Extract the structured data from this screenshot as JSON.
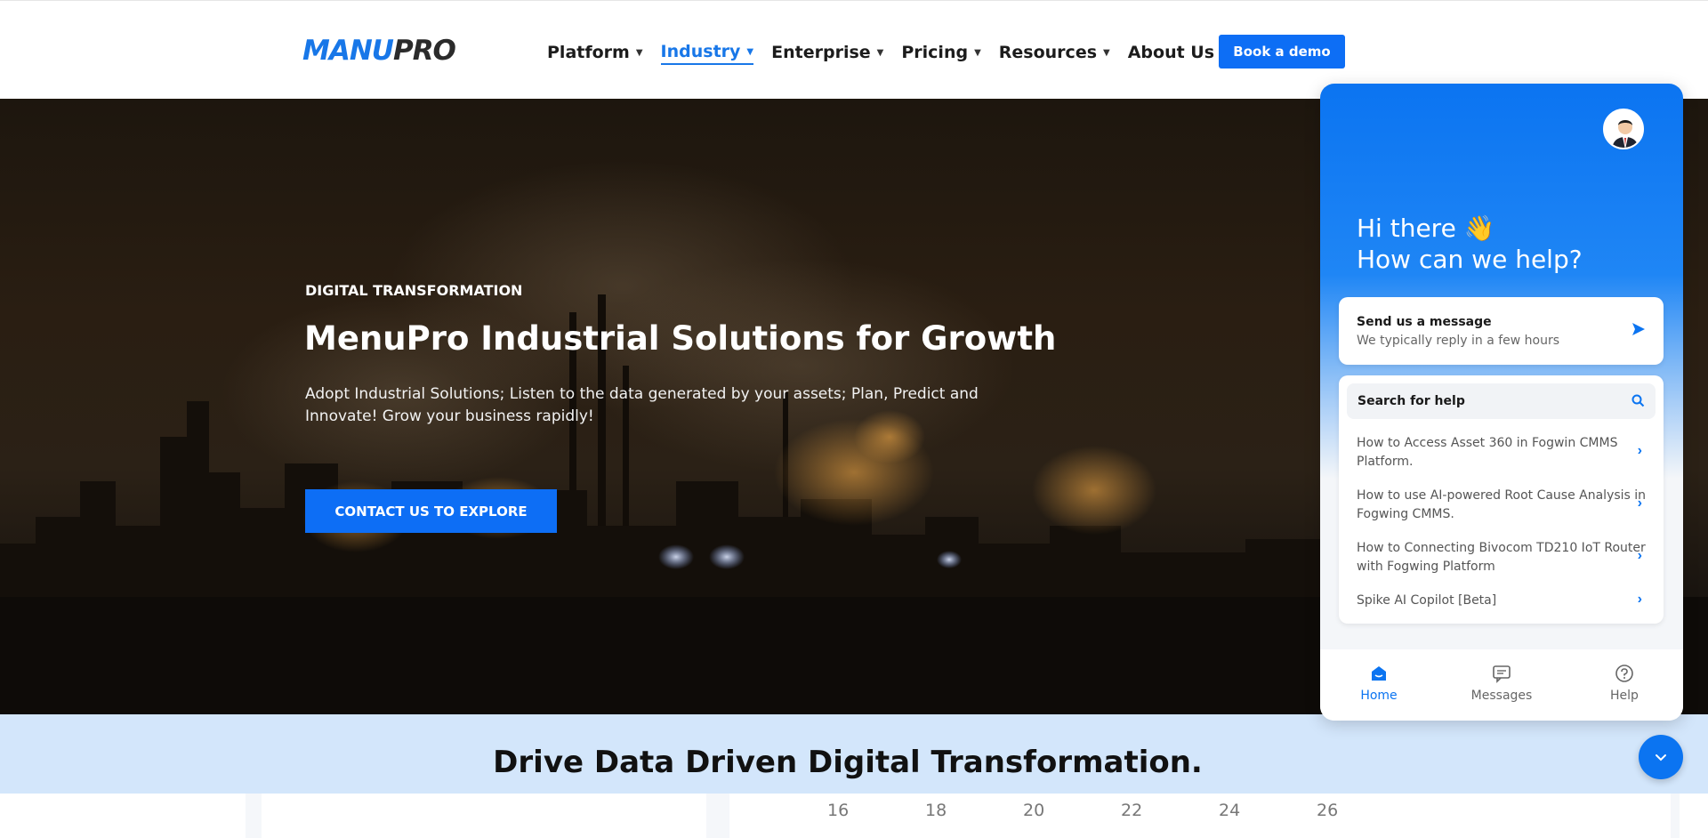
{
  "header": {
    "logo_part1": "MANU",
    "logo_part2": "PRO",
    "nav": [
      {
        "label": "Platform"
      },
      {
        "label": "Industry",
        "active": true
      },
      {
        "label": "Enterprise"
      },
      {
        "label": "Pricing"
      },
      {
        "label": "Resources"
      },
      {
        "label": "About Us"
      }
    ],
    "demo_label": "Book a demo"
  },
  "hero": {
    "eyebrow": "DIGITAL TRANSFORMATION",
    "title": "MenuPro Industrial Solutions for Growth",
    "subtitle": "Adopt Industrial Solutions; Listen to the data generated by your assets; Plan, Predict and Innovate! Grow your business rapidly!",
    "cta_label": "CONTACT US TO EXPLORE"
  },
  "band": {
    "title": "Drive Data Driven Digital Transformation."
  },
  "calendar": {
    "days": [
      "16",
      "18",
      "20",
      "22",
      "24",
      "26"
    ]
  },
  "chat": {
    "greeting_line1": "Hi there 👋",
    "greeting_line2": "How can we help?",
    "message_title": "Send us a message",
    "message_sub": "We typically reply in a few hours",
    "search_label": "Search for help",
    "articles": [
      {
        "title": "How to Access Asset 360 in Fogwin CMMS Platform."
      },
      {
        "title": "How to use AI-powered Root Cause Analysis in Fogwing CMMS."
      },
      {
        "title": "How to Connecting Bivocom TD210 IoT Router with Fogwing Platform"
      },
      {
        "title": "Spike AI Copilot [Beta]"
      }
    ],
    "tabs": [
      {
        "label": "Home",
        "icon": "home-icon"
      },
      {
        "label": "Messages",
        "icon": "messages-icon"
      },
      {
        "label": "Help",
        "icon": "help-icon"
      }
    ]
  },
  "colors": {
    "brand_blue": "#0d6ef5",
    "chat_blue": "#0b74f1",
    "band_bg": "#d3e6fb"
  }
}
